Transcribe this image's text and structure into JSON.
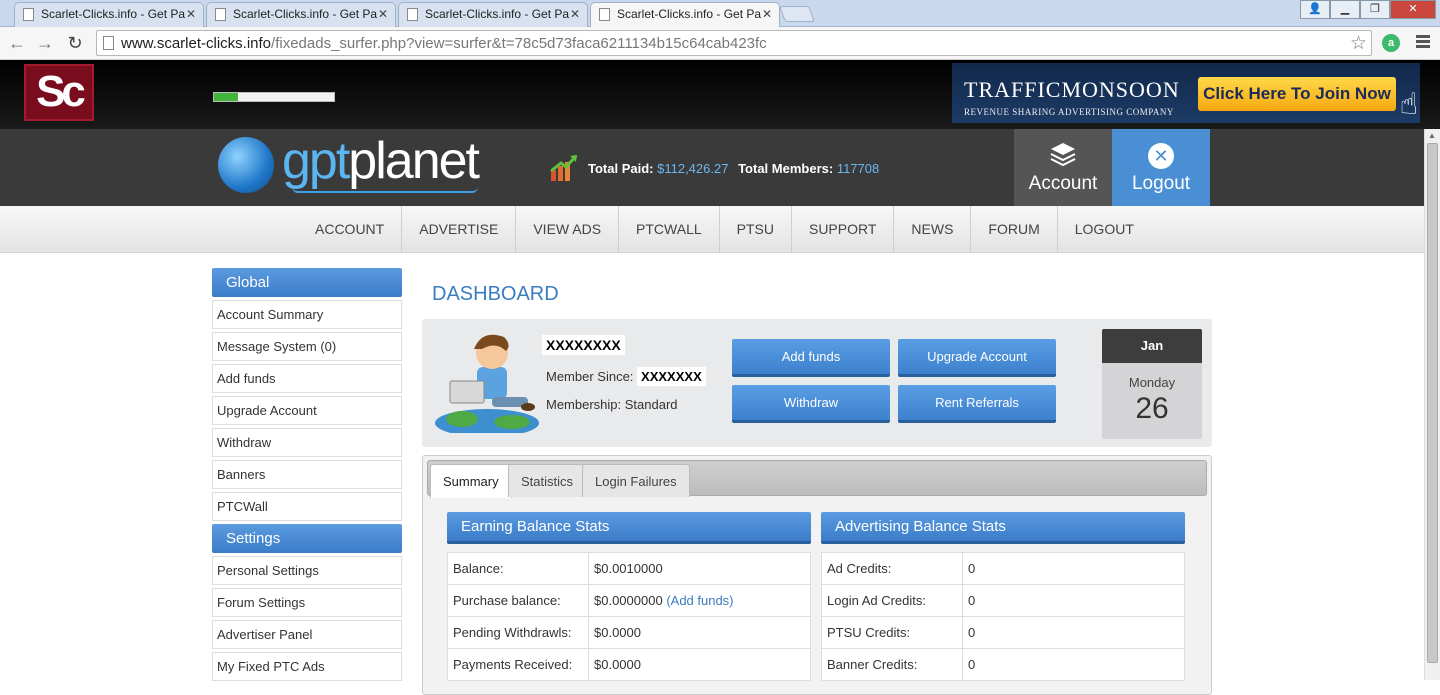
{
  "browser": {
    "tabs": [
      {
        "title": "Scarlet-Clicks.info - Get Pa"
      },
      {
        "title": "Scarlet-Clicks.info - Get Pa"
      },
      {
        "title": "Scarlet-Clicks.info - Get Pa"
      },
      {
        "title": "Scarlet-Clicks.info - Get Pa"
      }
    ],
    "url_host": "www.scarlet-clicks.info",
    "url_path": "/fixedads_surfer.php?view=surfer&t=78c5d73faca6211134b15c64cab423fc",
    "extension_letter": "a"
  },
  "site": {
    "logo_text": "Sc",
    "surf_progress": 0.2,
    "banner": {
      "name": "TRAFFICMONSOON",
      "subtitle": "REVENUE SHARING ADVERTISING COMPANY",
      "cta": "Click Here To Join Now"
    },
    "brand": {
      "part1": "gpt",
      "part2": "planet"
    },
    "stats": {
      "paid_label": "Total Paid:",
      "paid_value": "$112,426.27",
      "members_label": "Total Members:",
      "members_value": "117708"
    },
    "header_buttons": {
      "account": "Account",
      "logout": "Logout"
    },
    "nav": [
      "ACCOUNT",
      "ADVERTISE",
      "VIEW ADS",
      "PTCWALL",
      "PTSU",
      "SUPPORT",
      "NEWS",
      "FORUM",
      "LOGOUT"
    ]
  },
  "sidebar": {
    "global_head": "Global",
    "global_items": [
      "Account Summary",
      "Message System (0)",
      "Add funds",
      "Upgrade Account",
      "Withdraw",
      "Banners",
      "PTCWall"
    ],
    "settings_head": "Settings",
    "settings_items": [
      "Personal Settings",
      "Forum Settings",
      "Advertiser Panel",
      "My Fixed PTC Ads"
    ]
  },
  "dashboard": {
    "title": "DASHBOARD",
    "username": "XXXXXXXX",
    "member_since_label": "Member Since:",
    "member_since_value": "XXXXXXX",
    "membership": "Membership: Standard",
    "buttons": {
      "add_funds": "Add funds",
      "upgrade": "Upgrade Account",
      "withdraw": "Withdraw",
      "rent": "Rent Referrals"
    },
    "calendar": {
      "month": "Jan",
      "weekday": "Monday",
      "day": "26"
    }
  },
  "tabs": {
    "summary": "Summary",
    "statistics": "Statistics",
    "login_failures": "Login Failures"
  },
  "earning": {
    "title": "Earning Balance Stats",
    "rows": [
      {
        "k": "Balance:",
        "v": "$0.0010000"
      },
      {
        "k": "Purchase balance:",
        "v": "$0.0000000",
        "link": "(Add funds)"
      },
      {
        "k": "Pending Withdrawls:",
        "v": "$0.0000"
      },
      {
        "k": "Payments Received:",
        "v": "$0.0000"
      }
    ]
  },
  "advertising": {
    "title": "Advertising Balance Stats",
    "rows": [
      {
        "k": "Ad Credits:",
        "v": "0"
      },
      {
        "k": "Login Ad Credits:",
        "v": "0"
      },
      {
        "k": "PTSU Credits:",
        "v": "0"
      },
      {
        "k": "Banner Credits:",
        "v": "0"
      }
    ]
  }
}
